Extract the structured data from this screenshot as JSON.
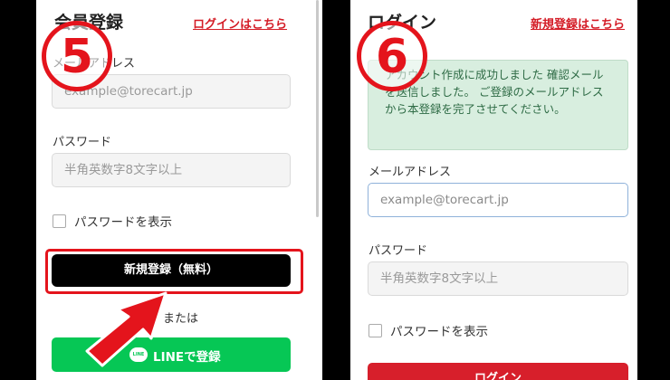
{
  "panel5": {
    "badge": "5",
    "title": "会員登録",
    "login_link": "ログインはこちら",
    "email_label": "メールアドレス",
    "email_placeholder": "example@torecart.jp",
    "password_label": "パスワード",
    "password_placeholder": "半角英数字8文字以上",
    "show_password": "パスワードを表示",
    "register_button": "新規登録（無料）",
    "or_text": "または",
    "line_button": "LINEで登録",
    "line_icon_text": "LINE"
  },
  "panel6": {
    "badge": "6",
    "title": "ログイン",
    "register_link": "新規登録はこちら",
    "notice": "アカウント作成に成功しました 確認メールを送信しました。 ご登録のメールアドレスから本登録を完了させてください。",
    "email_label": "メールアドレス",
    "email_placeholder": "example@torecart.jp",
    "password_label": "パスワード",
    "password_placeholder": "半角英数字8文字以上",
    "show_password": "パスワードを表示",
    "login_button": "ログイン"
  },
  "colors": {
    "accent_red": "#e4141c",
    "link_red": "#d41c26",
    "line_green": "#06c755",
    "notice_bg": "#d8eedf"
  }
}
